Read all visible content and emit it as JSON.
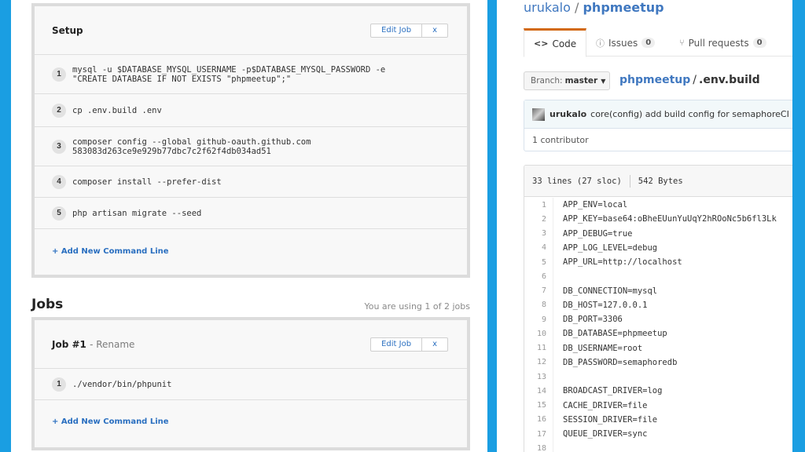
{
  "setup": {
    "title": "Setup",
    "edit_label": "Edit Job",
    "close_label": "x",
    "commands": [
      {
        "num": "1",
        "text": "mysql -u $DATABASE_MYSQL_USERNAME -p$DATABASE_MYSQL_PASSWORD -e\n\"CREATE DATABASE IF NOT EXISTS \"phpmeetup\";\""
      },
      {
        "num": "2",
        "text": "cp .env.build .env"
      },
      {
        "num": "3",
        "text": "composer config --global github-oauth.github.com\n583083d263ce9e929b77dbc7c2f62f4db034ad51"
      },
      {
        "num": "4",
        "text": "composer install --prefer-dist"
      },
      {
        "num": "5",
        "text": "php artisan migrate --seed"
      }
    ],
    "add_command_label": "+ Add New Command Line"
  },
  "jobs": {
    "heading": "Jobs",
    "usage": "You are using 1 of 2 jobs",
    "job": {
      "title": "Job #1",
      "rename_label": "- Rename",
      "edit_label": "Edit Job",
      "close_label": "x",
      "commands": [
        {
          "num": "1",
          "text": "./vendor/bin/phpunit"
        }
      ],
      "add_command_label": "+ Add New Command Line"
    }
  },
  "github": {
    "owner": "urukalo",
    "separator": "/",
    "repo": "phpmeetup",
    "tabs": [
      {
        "label": "Code",
        "icon": "<>",
        "count": null
      },
      {
        "label": "Issues",
        "icon": "ⓘ",
        "count": "0"
      },
      {
        "label": "Pull requests",
        "icon": "⑂",
        "count": "0"
      }
    ],
    "branch_label": "Branch:",
    "branch_value": "master",
    "path_repo": "phpmeetup",
    "path_file": ".env.build",
    "commit_author": "urukalo",
    "commit_message": "core(config) add build config for semaphoreCI",
    "contributors": "1 contributor",
    "file_lines_info": "33 lines (27 sloc)",
    "file_size": "542 Bytes",
    "code_lines": [
      {
        "n": "1",
        "t": "APP_ENV=local"
      },
      {
        "n": "2",
        "t": "APP_KEY=base64:oBheEUunYuUqY2hROoNc5b6fl3Lk"
      },
      {
        "n": "3",
        "t": "APP_DEBUG=true"
      },
      {
        "n": "4",
        "t": "APP_LOG_LEVEL=debug"
      },
      {
        "n": "5",
        "t": "APP_URL=http://localhost"
      },
      {
        "n": "6",
        "t": ""
      },
      {
        "n": "7",
        "t": "DB_CONNECTION=mysql"
      },
      {
        "n": "8",
        "t": "DB_HOST=127.0.0.1"
      },
      {
        "n": "9",
        "t": "DB_PORT=3306"
      },
      {
        "n": "10",
        "t": "DB_DATABASE=phpmeetup"
      },
      {
        "n": "11",
        "t": "DB_USERNAME=root"
      },
      {
        "n": "12",
        "t": "DB_PASSWORD=semaphoredb"
      },
      {
        "n": "13",
        "t": ""
      },
      {
        "n": "14",
        "t": "BROADCAST_DRIVER=log"
      },
      {
        "n": "15",
        "t": "CACHE_DRIVER=file"
      },
      {
        "n": "16",
        "t": "SESSION_DRIVER=file"
      },
      {
        "n": "17",
        "t": "QUEUE_DRIVER=sync"
      },
      {
        "n": "18",
        "t": ""
      }
    ]
  }
}
